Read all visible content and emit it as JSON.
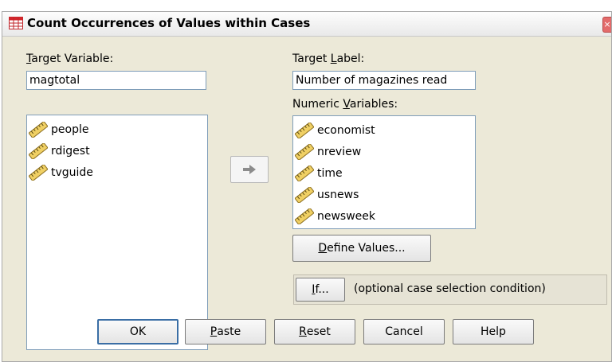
{
  "dialog": {
    "title": "Count Occurrences of Values within Cases",
    "close_glyph": "×"
  },
  "target_variable": {
    "label_mnemonic": "T",
    "label_rest": "arget Variable:",
    "value": "magtotal"
  },
  "target_label": {
    "label_prefix": "Target ",
    "label_mnemonic": "L",
    "label_rest": "abel:",
    "value": "Number of magazines read"
  },
  "source_list": {
    "items": [
      "people",
      "rdigest",
      "tvguide"
    ]
  },
  "numeric_variables": {
    "label_prefix": "Numeric ",
    "label_mnemonic": "V",
    "label_rest": "ariables:",
    "items": [
      "economist",
      "nreview",
      "time",
      "usnews",
      "newsweek"
    ]
  },
  "icons": {
    "title": "data-grid-icon",
    "variable": "scale-ruler-icon",
    "move": "right-arrow-icon"
  },
  "define_values": {
    "mnemonic": "D",
    "rest": "efine Values..."
  },
  "if_section": {
    "mnemonic": "I",
    "rest": "f...",
    "caption": "(optional case selection condition)"
  },
  "buttons": {
    "ok": {
      "text": "OK"
    },
    "paste": {
      "mnemonic": "P",
      "rest": "aste"
    },
    "reset": {
      "mnemonic": "R",
      "rest": "eset"
    },
    "cancel": {
      "text": "Cancel"
    },
    "help": {
      "text": "Help"
    }
  },
  "colors": {
    "dialog_bg": "#ece9d8",
    "field_border": "#7f9db9",
    "title_icon_red": "#d4262b",
    "ruler_yellow": "#f0d064"
  }
}
